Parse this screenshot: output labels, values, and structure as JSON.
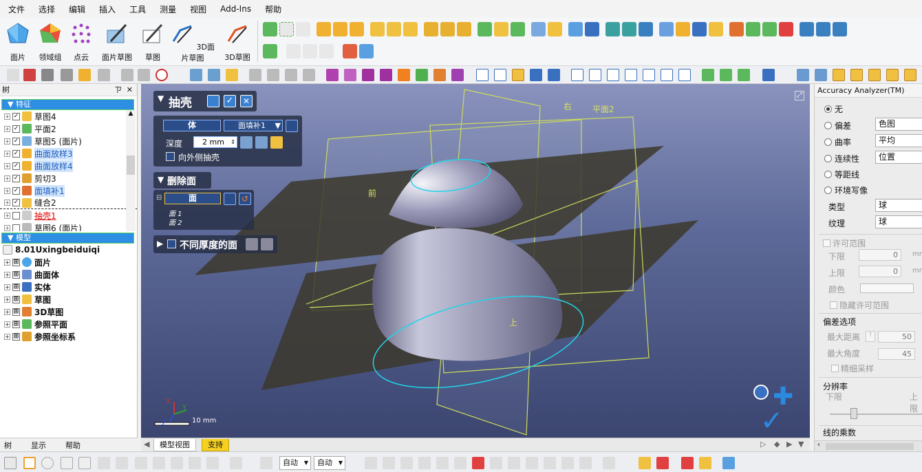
{
  "menu": [
    "文件",
    "选择",
    "编辑",
    "插入",
    "工具",
    "测量",
    "视图",
    "Add-Ins",
    "帮助"
  ],
  "ribbon": {
    "big_buttons": [
      "面片",
      "领域组",
      "点云",
      "面片草图",
      "草图",
      "3D面片草图",
      "3D草图"
    ]
  },
  "left_panel": {
    "header": "树",
    "pin": "ㄗ",
    "close": "✕",
    "features_header": "特征",
    "features": [
      {
        "label": "草图4",
        "checked": true
      },
      {
        "label": "平面2",
        "checked": true
      },
      {
        "label": "草图5 (面片)",
        "checked": true
      },
      {
        "label": "曲面放样3",
        "checked": true,
        "highlight": true
      },
      {
        "label": "曲面放样4",
        "checked": true,
        "highlight": true
      },
      {
        "label": "剪切3",
        "checked": true
      },
      {
        "label": "面填补1",
        "checked": true,
        "highlight": true
      },
      {
        "label": "缝合2",
        "checked": true
      },
      {
        "label": "抽壳1",
        "checked": false,
        "red": true
      },
      {
        "label": "草图6 (面片)",
        "checked": false
      },
      {
        "label": "…",
        "checked": false
      }
    ],
    "model_header": "模型",
    "model_root": "8.01Uxingbeiduiqi",
    "model_items": [
      "面片",
      "曲面体",
      "实体",
      "草图",
      "3D草图",
      "参照平面",
      "参照坐标系"
    ],
    "tabs": [
      "树",
      "显示",
      "帮助"
    ]
  },
  "shell_dialog": {
    "title": "抽壳",
    "body_label": "体",
    "body_value": "面填补1",
    "depth_label": "深度",
    "depth_value": "2 mm",
    "outward_label": "向外侧抽壳",
    "delete_face_title": "删除面",
    "face_label": "面",
    "face_items": [
      "面 1",
      "面 2"
    ],
    "varied_thickness_label": "不同厚度的面"
  },
  "viewport": {
    "labels": {
      "right": "右",
      "plane2": "平面2",
      "front": "前",
      "top": "上"
    },
    "scale_text": "10 mm",
    "axis_x": "X",
    "axis_y": "Y",
    "axis_z": "Z"
  },
  "viewport_tabs": [
    "模型视图",
    "支持"
  ],
  "right_panel": {
    "title": "Accuracy Analyzer(TM)",
    "options": [
      {
        "label": "无",
        "selected": true
      },
      {
        "label": "偏差",
        "value": "色图"
      },
      {
        "label": "曲率",
        "value": "平均"
      },
      {
        "label": "连续性",
        "value": "位置"
      },
      {
        "label": "等距线"
      },
      {
        "label": "环境写像"
      }
    ],
    "type_label": "类型",
    "type_value": "球",
    "texture_label": "纹理",
    "texture_value": "球",
    "allow_range_label": "许可范围",
    "lower_label": "下限",
    "lower_value": "0",
    "upper_label": "上限",
    "upper_value": "0",
    "unit": "mm",
    "color_label": "颜色",
    "hide_range_label": "隐藏许可范围",
    "deviation_options_label": "偏差选项",
    "max_distance_label": "最大距离",
    "max_distance_value": "50",
    "max_angle_label": "最大角度",
    "max_angle_value": "45",
    "angle_unit": "°",
    "fine_sampling_label": "精细采样",
    "resolution_label": "分辨率",
    "res_lower": "下限",
    "res_upper": "上限",
    "line_multiplier_label": "线的乘数"
  },
  "statusbar": {
    "combo1": "自动",
    "combo2": "自动"
  },
  "colors": {
    "accent_blue": "#2e8ee3",
    "plane_yellow": "#cddc5a",
    "cyan_edge": "#22d4e8"
  }
}
